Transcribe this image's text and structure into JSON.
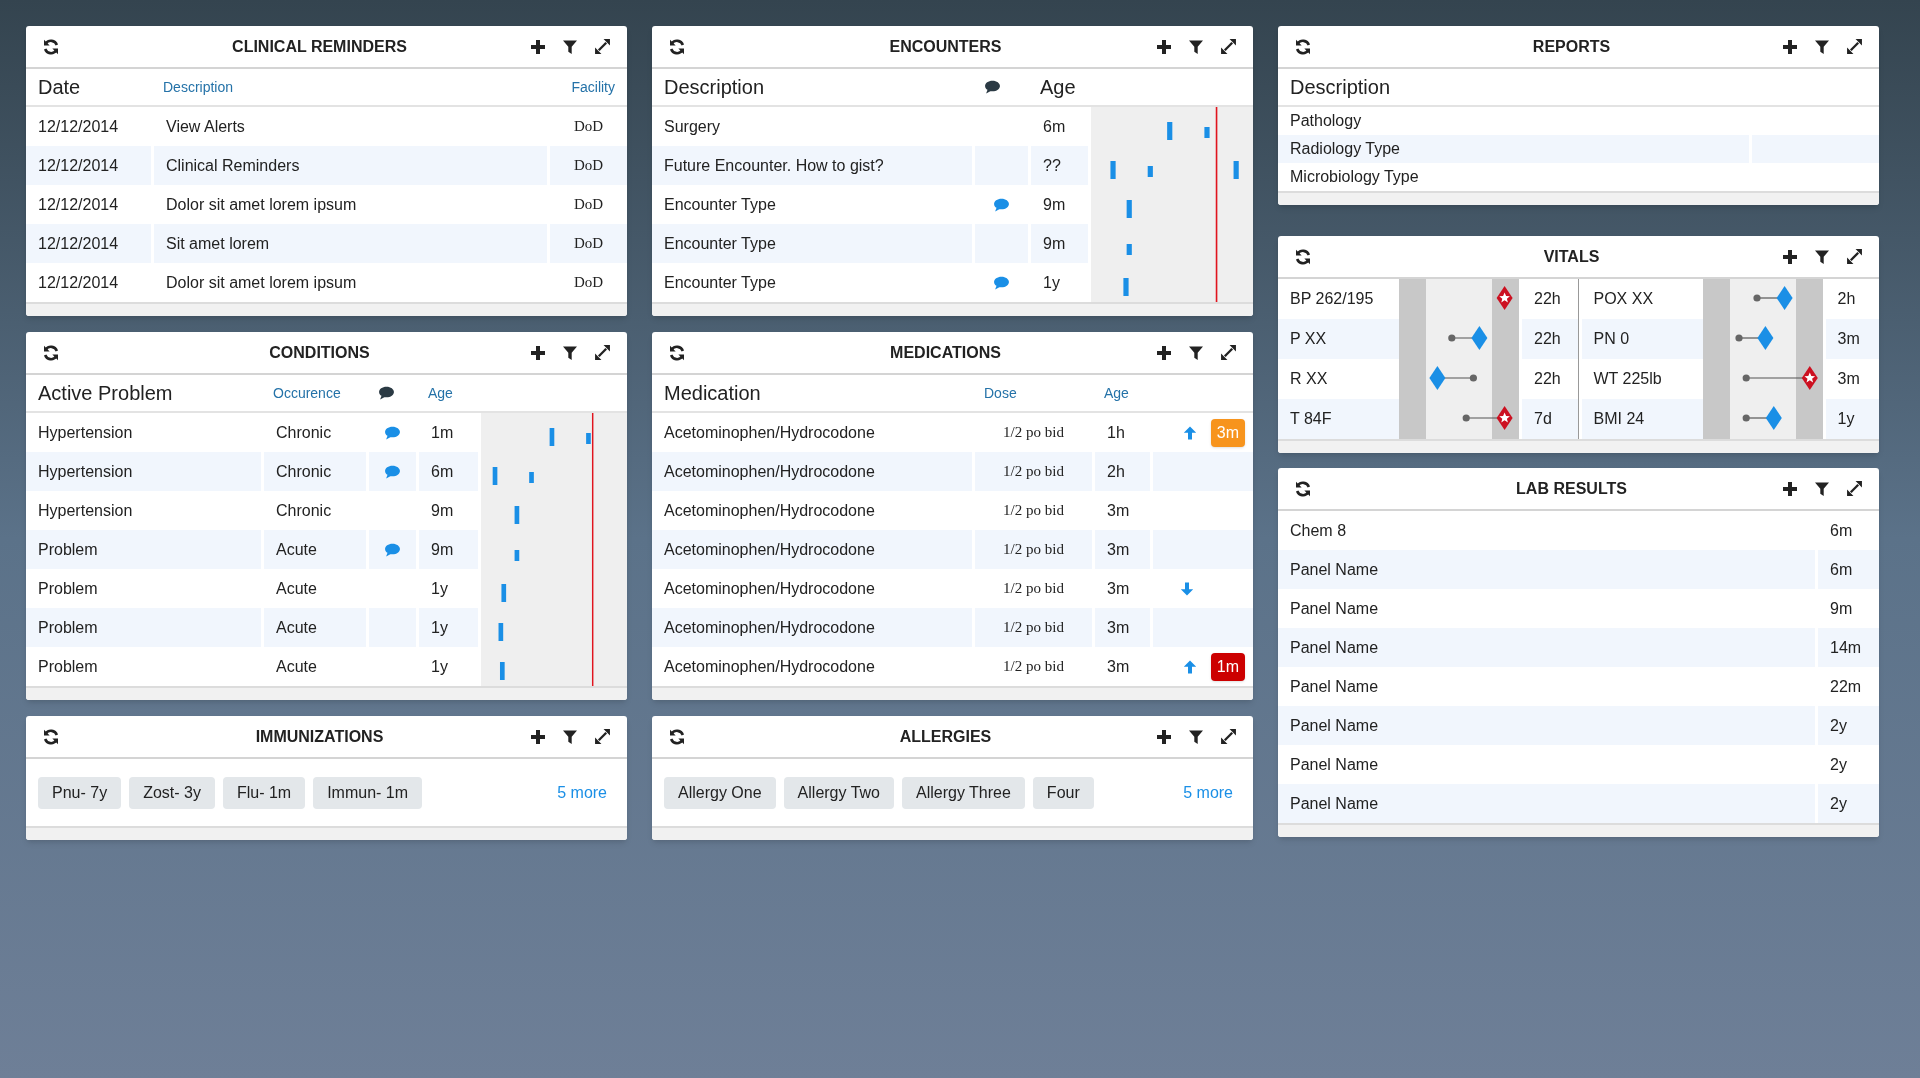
{
  "clinical_reminders": {
    "title": "CLINICAL REMINDERS",
    "columns": [
      {
        "label": "Date",
        "kind": "title"
      },
      {
        "label": "Description",
        "kind": "link"
      },
      {
        "label": "Facility",
        "kind": "link"
      }
    ],
    "rows": [
      {
        "date": "12/12/2014",
        "description": "View Alerts",
        "facility": "DoD"
      },
      {
        "date": "12/12/2014",
        "description": "Clinical Reminders",
        "facility": "DoD"
      },
      {
        "date": "12/12/2014",
        "description": "Dolor sit amet lorem ipsum",
        "facility": "DoD"
      },
      {
        "date": "12/12/2014",
        "description": "Sit amet lorem",
        "facility": "DoD"
      },
      {
        "date": "12/12/2014",
        "description": "Dolor sit amet lorem ipsum",
        "facility": "DoD"
      }
    ]
  },
  "encounters": {
    "title": "ENCOUNTERS",
    "columns": [
      {
        "label": "Description",
        "kind": "title"
      },
      {
        "kind": "comment"
      },
      {
        "label": "Age",
        "kind": "title"
      }
    ],
    "rows": [
      {
        "description": "Surgery",
        "comment": false,
        "age": "6m"
      },
      {
        "description": "Future Encounter. How to gist?",
        "comment": false,
        "age": "??"
      },
      {
        "description": "Encounter Type",
        "comment": true,
        "age": "9m"
      },
      {
        "description": "Encounter Type",
        "comment": false,
        "age": "9m"
      },
      {
        "description": "Encounter Type",
        "comment": true,
        "age": "1y"
      }
    ]
  },
  "reports": {
    "title": "REPORTS",
    "columns": [
      {
        "label": "Description",
        "kind": "title"
      }
    ],
    "rows": [
      {
        "description": "Pathology"
      },
      {
        "description": "Radiology Type"
      },
      {
        "description": "Microbiology Type"
      }
    ]
  },
  "conditions": {
    "title": "CONDITIONS",
    "columns": [
      {
        "label": "Active Problem",
        "kind": "title"
      },
      {
        "label": "Occurence",
        "kind": "link"
      },
      {
        "kind": "comment"
      },
      {
        "label": "Age",
        "kind": "link"
      }
    ],
    "rows": [
      {
        "problem": "Hypertension",
        "occurrence": "Chronic",
        "comment": true,
        "age": "1m"
      },
      {
        "problem": "Hypertension",
        "occurrence": "Chronic",
        "comment": true,
        "age": "6m"
      },
      {
        "problem": "Hypertension",
        "occurrence": "Chronic",
        "comment": false,
        "age": "9m"
      },
      {
        "problem": "Problem",
        "occurrence": "Acute",
        "comment": true,
        "age": "9m"
      },
      {
        "problem": "Problem",
        "occurrence": "Acute",
        "comment": false,
        "age": "1y"
      },
      {
        "problem": "Problem",
        "occurrence": "Acute",
        "comment": false,
        "age": "1y"
      },
      {
        "problem": "Problem",
        "occurrence": "Acute",
        "comment": false,
        "age": "1y"
      }
    ]
  },
  "medications": {
    "title": "MEDICATIONS",
    "columns": [
      {
        "label": "Medication",
        "kind": "title"
      },
      {
        "label": "Dose",
        "kind": "link"
      },
      {
        "label": "Age",
        "kind": "link"
      }
    ],
    "rows": [
      {
        "medication": "Acetominophen/Hydrocodone",
        "dose": "1/2 po bid",
        "age": "1h",
        "trend_up": true,
        "trend_down": false,
        "badge": {
          "text": "3m",
          "color": "#f7941d"
        }
      },
      {
        "medication": "Acetominophen/Hydrocodone",
        "dose": "1/2 po bid",
        "age": "2h",
        "trend_up": false,
        "trend_down": false
      },
      {
        "medication": "Acetominophen/Hydrocodone",
        "dose": "1/2 po bid",
        "age": "3m",
        "trend_up": false,
        "trend_down": false
      },
      {
        "medication": "Acetominophen/Hydrocodone",
        "dose": "1/2 po bid",
        "age": "3m",
        "trend_up": false,
        "trend_down": false
      },
      {
        "medication": "Acetominophen/Hydrocodone",
        "dose": "1/2 po bid",
        "age": "3m",
        "trend_up": false,
        "trend_down": true
      },
      {
        "medication": "Acetominophen/Hydrocodone",
        "dose": "1/2 po bid",
        "age": "3m",
        "trend_up": false,
        "trend_down": false
      },
      {
        "medication": "Acetominophen/Hydrocodone",
        "dose": "1/2 po bid",
        "age": "3m",
        "trend_up": true,
        "trend_down": false,
        "badge": {
          "text": "1m",
          "color": "#cc0000"
        }
      }
    ]
  },
  "vitals": {
    "title": "VITALS",
    "items": [
      {
        "label": "BP 262/195",
        "age": "22h",
        "alert": true
      },
      {
        "label": "POX XX",
        "age": "2h",
        "alert": false
      },
      {
        "label": "P XX",
        "age": "22h",
        "alert": false
      },
      {
        "label": "PN 0",
        "age": "3m",
        "alert": false
      },
      {
        "label": "R XX",
        "age": "22h",
        "alert": false
      },
      {
        "label": "WT 225lb",
        "age": "3m",
        "alert": true
      },
      {
        "label": "T 84F",
        "age": "7d",
        "alert": true
      },
      {
        "label": "BMI 24",
        "age": "1y",
        "alert": false
      }
    ]
  },
  "immunizations": {
    "title": "IMMUNIZATIONS",
    "chips": [
      "Pnu- 7y",
      "Zost- 3y",
      "Flu- 1m",
      "Immun- 1m"
    ],
    "more": "5 more"
  },
  "allergies": {
    "title": "ALLERGIES",
    "chips": [
      "Allergy One",
      "Allergy Two",
      "Allergy Three",
      "Four"
    ],
    "more": "5 more"
  },
  "lab_results": {
    "title": "LAB RESULTS",
    "rows": [
      {
        "name": "Chem 8",
        "age": "6m"
      },
      {
        "name": "Panel Name",
        "age": "6m"
      },
      {
        "name": "Panel Name",
        "age": "9m"
      },
      {
        "name": "Panel Name",
        "age": "14m"
      },
      {
        "name": "Panel Name",
        "age": "22m"
      },
      {
        "name": "Panel Name",
        "age": "2y"
      },
      {
        "name": "Panel Name",
        "age": "2y"
      },
      {
        "name": "Panel Name",
        "age": "2y"
      }
    ]
  }
}
